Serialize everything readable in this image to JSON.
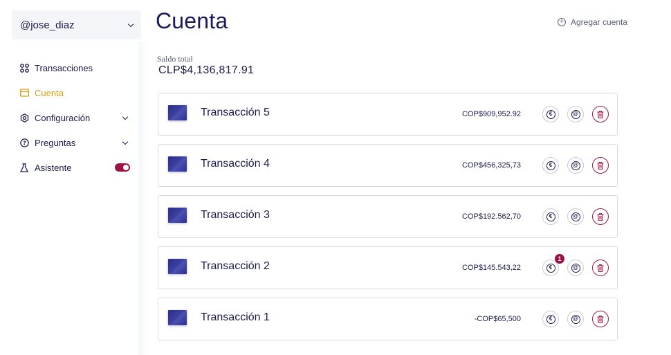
{
  "user": {
    "handle": "@jose_diaz"
  },
  "nav": {
    "items": [
      {
        "label": "Transacciones",
        "icon": "grid-icon",
        "active": false
      },
      {
        "label": "Cuenta",
        "icon": "wallet-icon",
        "active": true
      },
      {
        "label": "Configuración",
        "icon": "gear-icon",
        "expandable": true
      },
      {
        "label": "Preguntas",
        "icon": "question-icon",
        "expandable": true
      },
      {
        "label": "Asistente",
        "icon": "flask-icon",
        "toggle_on": true
      }
    ]
  },
  "page": {
    "title": "Cuenta",
    "add_account_label": "Agregar cuenta"
  },
  "balance": {
    "label": "Saldo total",
    "value": "CLP$4,136,817.91"
  },
  "transactions": [
    {
      "name": "Transacción 5",
      "amount": "COP$909,952.92",
      "badge": ""
    },
    {
      "name": "Transacción 4",
      "amount": "COP$456,325,73",
      "badge": ""
    },
    {
      "name": "Transacción 3",
      "amount": "COP$192.562,70",
      "badge": ""
    },
    {
      "name": "Transacción 2",
      "amount": "COP$145.543,22",
      "badge": "1"
    },
    {
      "name": "Transacción 1",
      "amount": "-COP$65,500",
      "badge": ""
    }
  ],
  "colors": {
    "primary": "#1a1a4b",
    "accent": "#d4a017",
    "danger": "#9e1144",
    "muted_bg": "#f4f5f9"
  }
}
